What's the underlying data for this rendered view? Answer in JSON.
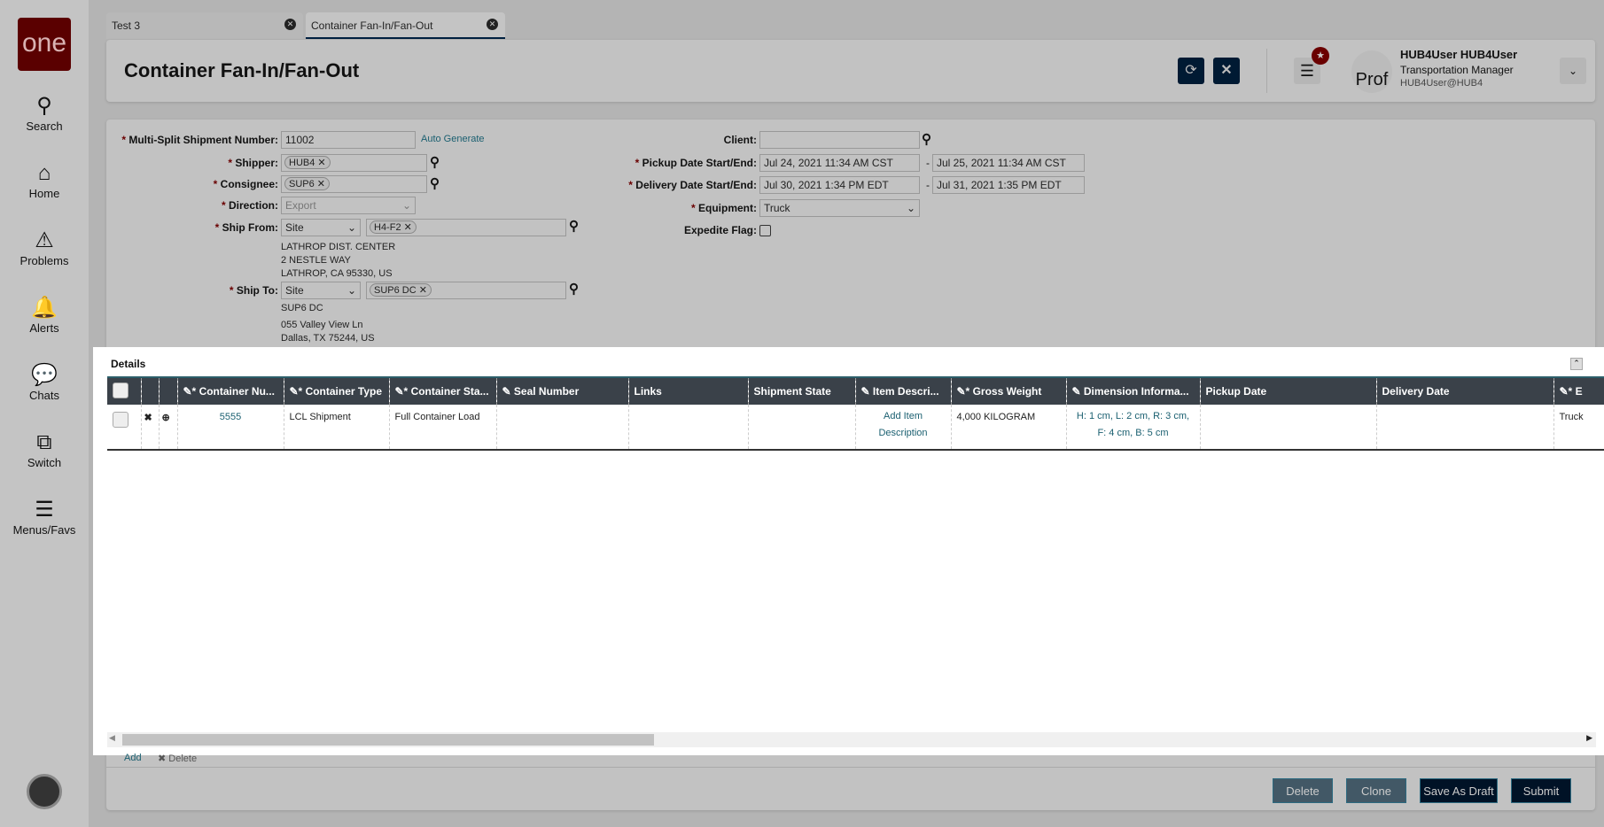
{
  "sidebar": {
    "logo": "one",
    "items": [
      {
        "label": "Search",
        "icon": "search-icon"
      },
      {
        "label": "Home",
        "icon": "home-icon"
      },
      {
        "label": "Problems",
        "icon": "warning-icon"
      },
      {
        "label": "Alerts",
        "icon": "bell-icon"
      },
      {
        "label": "Chats",
        "icon": "chat-icon"
      },
      {
        "label": "Switch",
        "icon": "switch-icon"
      },
      {
        "label": "Menus/Favs",
        "icon": "menu-icon"
      }
    ]
  },
  "tabs": [
    {
      "label": "Test 3"
    },
    {
      "label": "Container Fan-In/Fan-Out"
    }
  ],
  "header": {
    "title": "Container Fan-In/Fan-Out",
    "user_name": "HUB4User HUB4User",
    "user_role": "Transportation Manager",
    "user_email": "HUB4User@HUB4",
    "avatar_text": "Prof"
  },
  "form": {
    "shipment_number_label": "Multi-Split Shipment Number:",
    "shipment_number": "11002",
    "auto_generate": "Auto Generate",
    "shipper_label": "Shipper:",
    "shipper": "HUB4",
    "consignee_label": "Consignee:",
    "consignee": "SUP6",
    "direction_label": "Direction:",
    "direction": "Export",
    "ship_from_label": "Ship From:",
    "ship_from_type": "Site",
    "ship_from": "H4-F2",
    "ship_from_address": [
      "LATHROP DIST. CENTER",
      "2 NESTLE WAY",
      "LATHROP, CA 95330, US"
    ],
    "ship_to_label": "Ship To:",
    "ship_to_type": "Site",
    "ship_to": "SUP6 DC",
    "ship_to_address": [
      "SUP6 DC",
      "055 Valley View Ln",
      "Dallas, TX 75244, US"
    ],
    "client_label": "Client:",
    "client": "",
    "pickup_label": "Pickup Date Start/End:",
    "pickup_start": "Jul 24, 2021 11:34 AM CST",
    "pickup_end": "Jul 25, 2021 11:34 AM CST",
    "delivery_label": "Delivery Date Start/End:",
    "delivery_start": "Jul 30, 2021 1:34 PM EDT",
    "delivery_end": "Jul 31, 2021 1:35 PM EDT",
    "equipment_label": "Equipment:",
    "equipment": "Truck",
    "expedite_label": "Expedite Flag:"
  },
  "details": {
    "title": "Details",
    "columns": [
      "Container Nu...",
      "Container Type",
      "Container Sta...",
      "Seal Number",
      "Links",
      "Shipment State",
      "Item Descri...",
      "Gross Weight",
      "Dimension Informa...",
      "Pickup Date",
      "Delivery Date",
      "E"
    ],
    "row": {
      "container_number": "5555",
      "container_type": "LCL Shipment",
      "container_status": "Full Container Load",
      "seal_number": "",
      "links": "",
      "shipment_state": "",
      "item_description": "Add Item Description",
      "gross_weight": "4,000 KILOGRAM",
      "dimension": "H: 1 cm, L: 2 cm, R: 3 cm, F: 4 cm, B: 5 cm",
      "pickup_date": "",
      "delivery_date": "",
      "equipment": "Truck"
    },
    "add": "Add",
    "delete": "Delete"
  },
  "footer": {
    "delete": "Delete",
    "clone": "Clone",
    "save_draft": "Save As Draft",
    "submit": "Submit"
  }
}
